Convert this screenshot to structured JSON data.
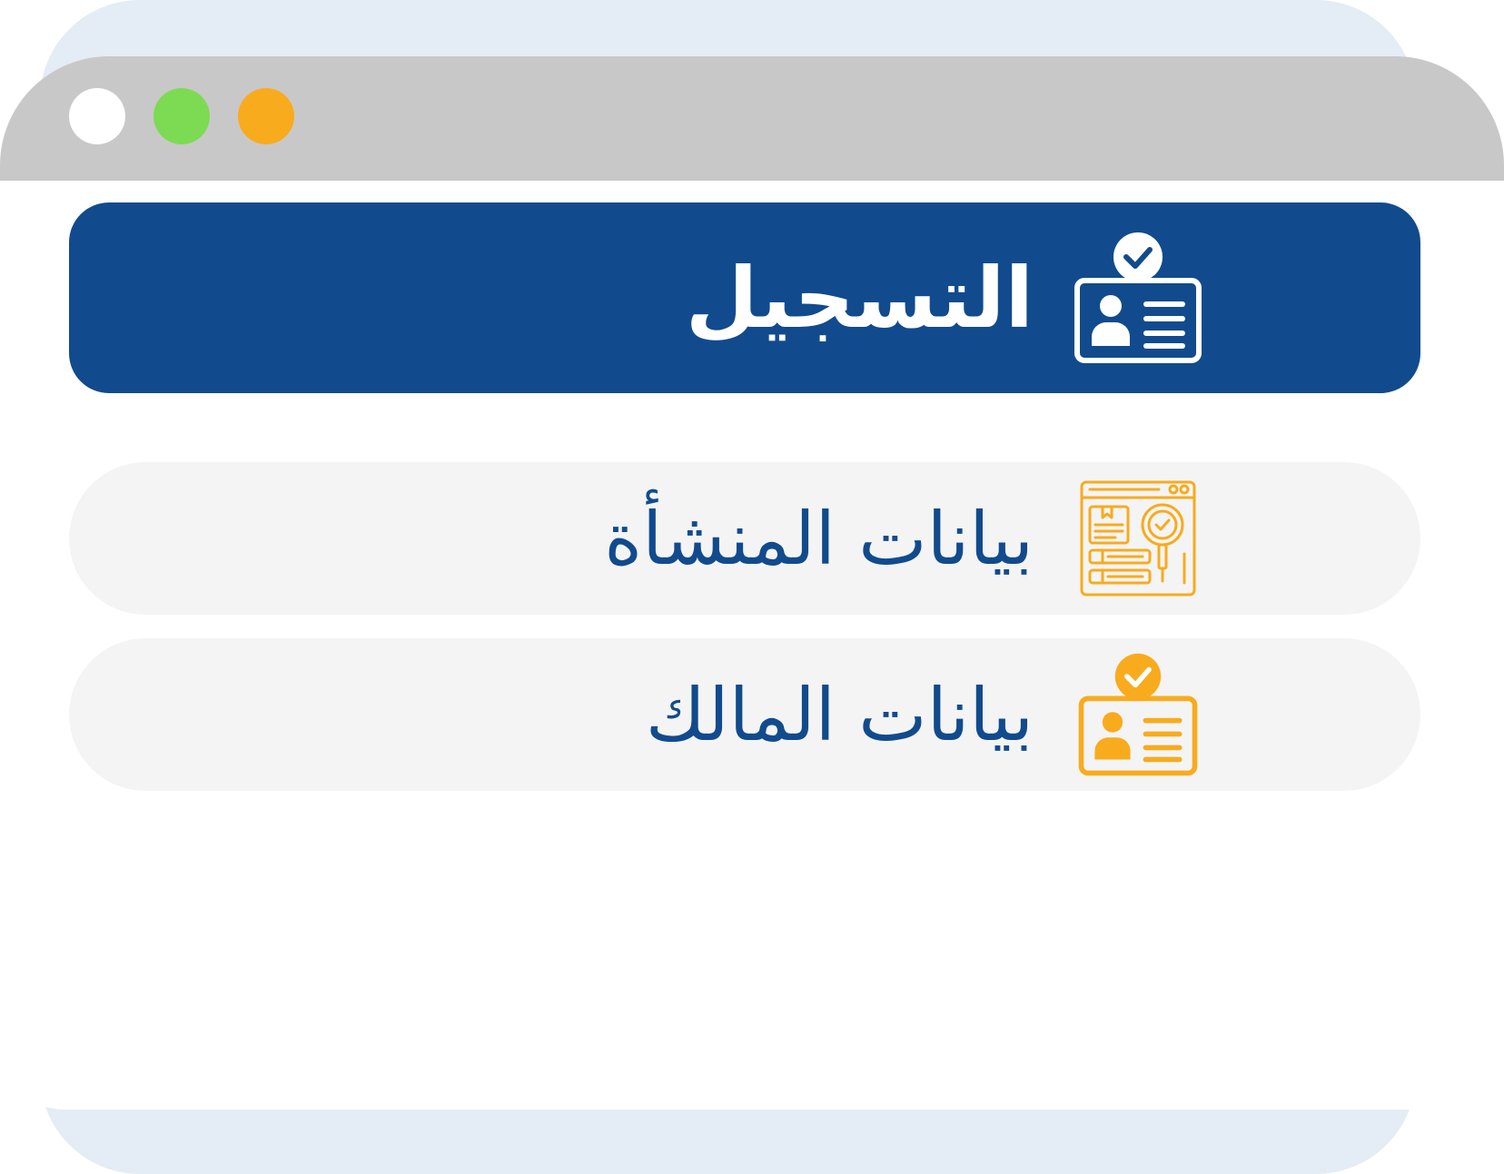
{
  "window": {
    "controls": [
      "close",
      "maximize",
      "minimize"
    ]
  },
  "colors": {
    "titlebar": "#c9c8c9",
    "back_panel": "#e4ecf5",
    "primary": "#114b8d",
    "accent": "#f8ab1d",
    "dot_green": "#7cdb52",
    "card_bg": "#f4f4f5"
  },
  "menu": {
    "header": {
      "label": "التسجيل",
      "icon": "id-card-check-icon"
    },
    "items": [
      {
        "label": "بيانات المنشأة",
        "icon": "document-inspect-icon"
      },
      {
        "label": "بيانات المالك",
        "icon": "id-card-check-icon"
      }
    ]
  }
}
